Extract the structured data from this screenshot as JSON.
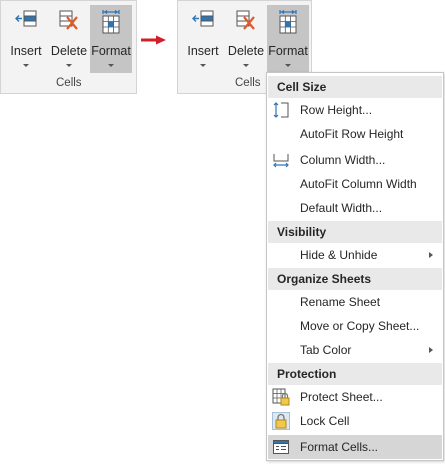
{
  "left_ribbon": {
    "buttons": [
      {
        "label": "Insert",
        "icon": "insert-cells-icon"
      },
      {
        "label": "Delete",
        "icon": "delete-cells-icon"
      },
      {
        "label": "Format",
        "icon": "format-cells-icon",
        "active": true
      }
    ],
    "group_label": "Cells"
  },
  "arrow": {
    "color": "#d11f2a"
  },
  "right_ribbon": {
    "buttons": [
      {
        "label": "Insert",
        "icon": "insert-cells-icon"
      },
      {
        "label": "Delete",
        "icon": "delete-cells-icon"
      },
      {
        "label": "Format",
        "icon": "format-cells-icon",
        "active": true
      }
    ],
    "group_label": "Cells"
  },
  "menu": {
    "sections": [
      {
        "header": "Cell Size",
        "items": [
          "Row Height...",
          "AutoFit Row Height",
          "Column Width...",
          "AutoFit Column Width",
          "Default Width..."
        ]
      },
      {
        "header": "Visibility",
        "items": [
          "Hide & Unhide"
        ]
      },
      {
        "header": "Organize Sheets",
        "items": [
          "Rename Sheet",
          "Move or Copy Sheet...",
          "Tab Color"
        ]
      },
      {
        "header": "Protection",
        "items": [
          "Protect Sheet...",
          "Lock Cell",
          "Format Cells..."
        ]
      }
    ],
    "highlighted_item": "Format Cells..."
  },
  "colors": {
    "ribbon_bg": "#f3f3f3",
    "active_button": "#c5c5c5",
    "section_bg": "#e9e9e9",
    "highlight": "#d6d6d6",
    "icon_blue": "#2e75b6",
    "delete_red": "#e05a2b"
  }
}
